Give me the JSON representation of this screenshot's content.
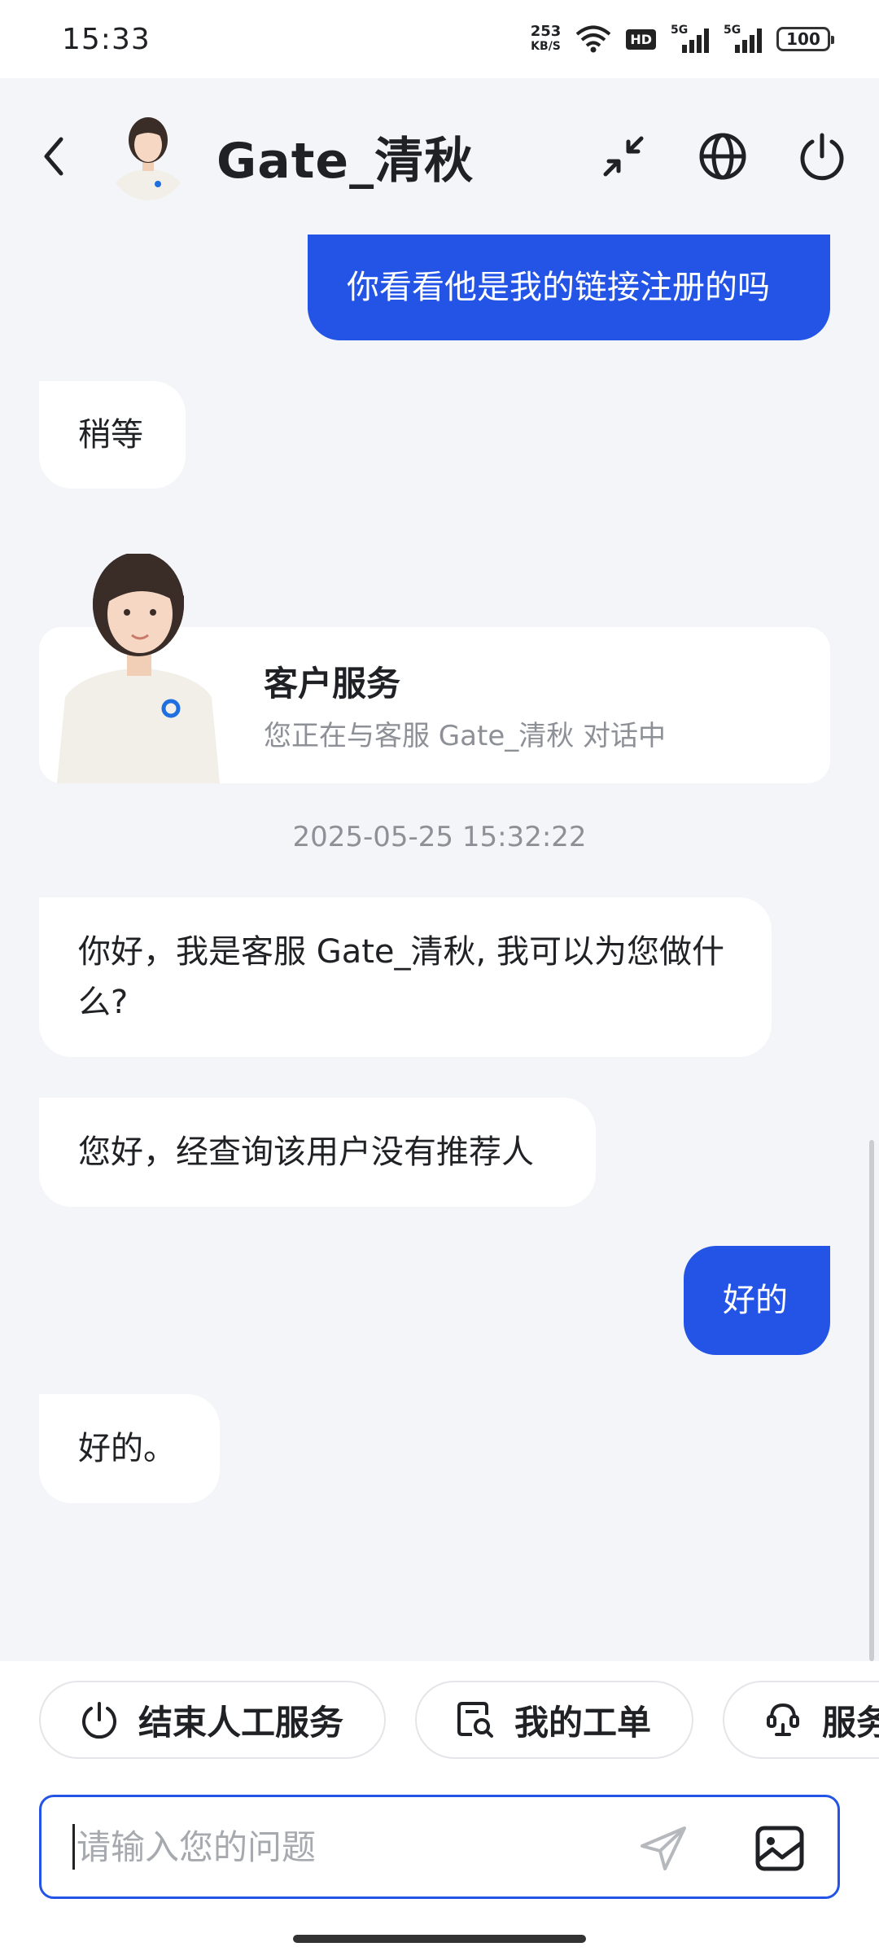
{
  "status_bar": {
    "time": "15:33",
    "net_speed": "253",
    "net_unit": "KB/S",
    "hd_label": "HD",
    "signal_label": "5G",
    "battery": "100"
  },
  "header": {
    "title": "Gate_清秋",
    "icons": [
      "back-icon",
      "avatar",
      "minimize-icon",
      "globe-icon",
      "power-icon"
    ]
  },
  "messages": [
    {
      "side": "out",
      "text": "你看看他是我的链接注册的吗"
    },
    {
      "side": "in",
      "text": "稍等"
    },
    {
      "side": "in",
      "text": "你好，我是客服 Gate_清秋, 我可以为您做什么?"
    },
    {
      "side": "in",
      "text": "您好，经查询该用户没有推荐人"
    },
    {
      "side": "out",
      "text": "好的"
    },
    {
      "side": "in",
      "text": "好的。"
    }
  ],
  "agent_card": {
    "title": "客户服务",
    "subtitle": "您正在与客服 Gate_清秋 对话中"
  },
  "timestamp": "2025-05-25 15:32:22",
  "quick_actions": [
    {
      "label": "结束人工服务",
      "icon": "power-icon"
    },
    {
      "label": "我的工单",
      "icon": "ticket-search-icon"
    },
    {
      "label": "服务",
      "icon": "service-icon"
    }
  ],
  "input": {
    "placeholder": "请输入您的问题",
    "value": ""
  },
  "colors": {
    "accent": "#2354e6",
    "background": "#f3f5f8"
  }
}
